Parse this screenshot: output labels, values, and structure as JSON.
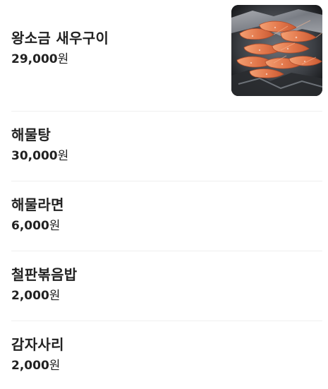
{
  "menu": {
    "items": [
      {
        "name": "왕소금 새우구이",
        "price": "29,000",
        "unit": "원",
        "photo": "grilled-shrimp-photo"
      },
      {
        "name": "해물탕",
        "price": "30,000",
        "unit": "원"
      },
      {
        "name": "해물라면",
        "price": "6,000",
        "unit": "원"
      },
      {
        "name": "철판볶음밥",
        "price": "2,000",
        "unit": "원"
      },
      {
        "name": "감자사리",
        "price": "2,000",
        "unit": "원"
      }
    ]
  }
}
